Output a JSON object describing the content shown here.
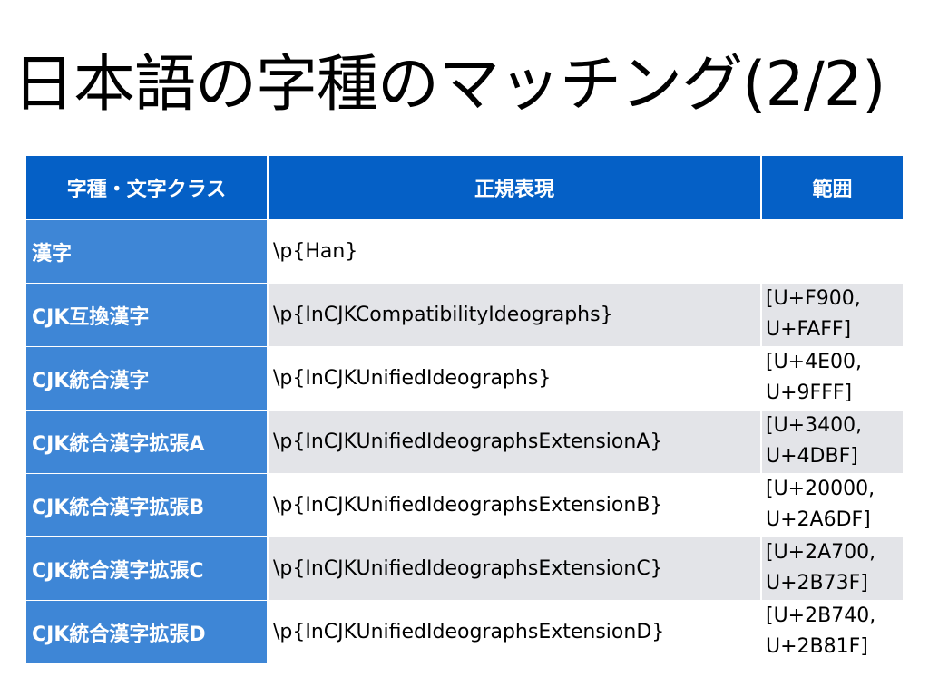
{
  "title": "日本語の字種のマッチング(2/2)",
  "table": {
    "headers": [
      "字種・文字クラス",
      "正規表現",
      "範囲"
    ],
    "rows": [
      {
        "class": "漢字",
        "regex": "\\p{Han}",
        "range_start": "",
        "range_end": ""
      },
      {
        "class": "CJK互換漢字",
        "regex": "\\p{InCJKCompatibilityIdeographs}",
        "range_start": "[U+F900,",
        "range_end": "U+FAFF]"
      },
      {
        "class": "CJK統合漢字",
        "regex": "\\p{InCJKUnifiedIdeographs}",
        "range_start": "[U+4E00,",
        "range_end": "U+9FFF]"
      },
      {
        "class": "CJK統合漢字拡張A",
        "regex": "\\p{InCJKUnifiedIdeographsExtensionA}",
        "range_start": "[U+3400,",
        "range_end": "U+4DBF]"
      },
      {
        "class": "CJK統合漢字拡張B",
        "regex": "\\p{InCJKUnifiedIdeographsExtensionB}",
        "range_start": "[U+20000,",
        "range_end": "U+2A6DF]"
      },
      {
        "class": "CJK統合漢字拡張C",
        "regex": "\\p{InCJKUnifiedIdeographsExtensionC}",
        "range_start": "[U+2A700,",
        "range_end": "U+2B73F]"
      },
      {
        "class": "CJK統合漢字拡張D",
        "regex": "\\p{InCJKUnifiedIdeographsExtensionD}",
        "range_start": "[U+2B740,",
        "range_end": "U+2B81F]"
      }
    ]
  },
  "colors": {
    "header_bg": "#0560c6",
    "class_cell_bg": "#3e86d6",
    "row_alt_bg": "#e3e4e8",
    "row_bg": "#ffffff"
  }
}
